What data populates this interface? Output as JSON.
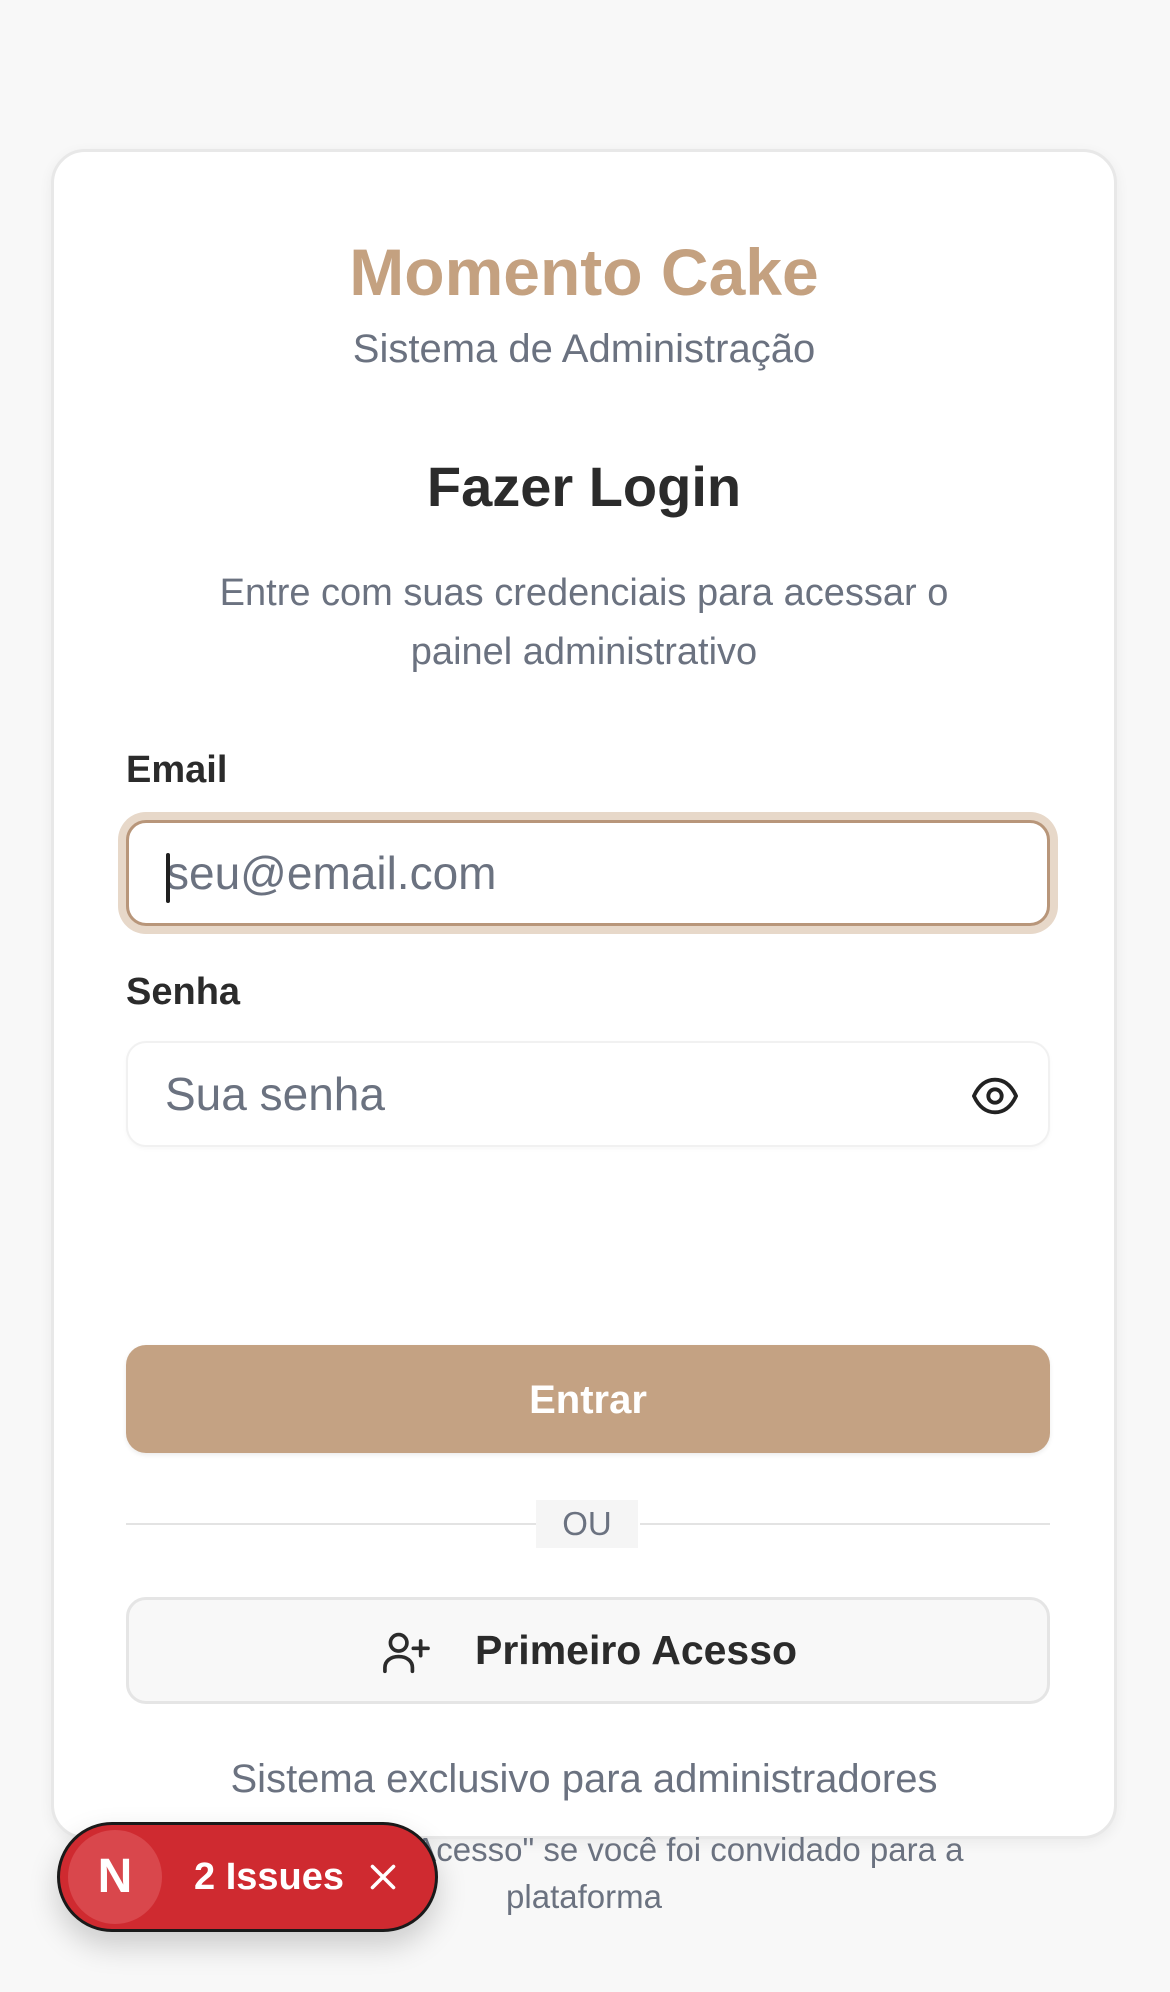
{
  "brand": {
    "name": "Momento Cake",
    "subtitle": "Sistema de Administração"
  },
  "login": {
    "title": "Fazer Login",
    "description": "Entre com suas credenciais para acessar o painel administrativo"
  },
  "form": {
    "email_label": "Email",
    "email_placeholder": "seu@email.com",
    "email_value": "",
    "password_label": "Senha",
    "password_placeholder": "Sua senha",
    "password_value": "",
    "password_toggle_icon": "eye-icon",
    "submit_label": "Entrar"
  },
  "divider": {
    "text": "OU"
  },
  "first_access": {
    "label": "Primeiro Acesso",
    "icon": "user-plus-icon"
  },
  "footer": {
    "line1": "Sistema exclusivo para administradores",
    "line2": "Use \"Primeiro Acesso\" se você foi convidado para a plataforma"
  },
  "dev_overlay": {
    "badge_letter": "N",
    "issues_label": "2 Issues",
    "close_icon": "close-icon"
  },
  "colors": {
    "brand": "#c4a180",
    "primary_button": "#c4a283",
    "focus_ring": "#e7d8c9",
    "issues_badge": "#cf2a30",
    "text_muted": "#6b7280",
    "text_dark": "#2b2b2b"
  }
}
